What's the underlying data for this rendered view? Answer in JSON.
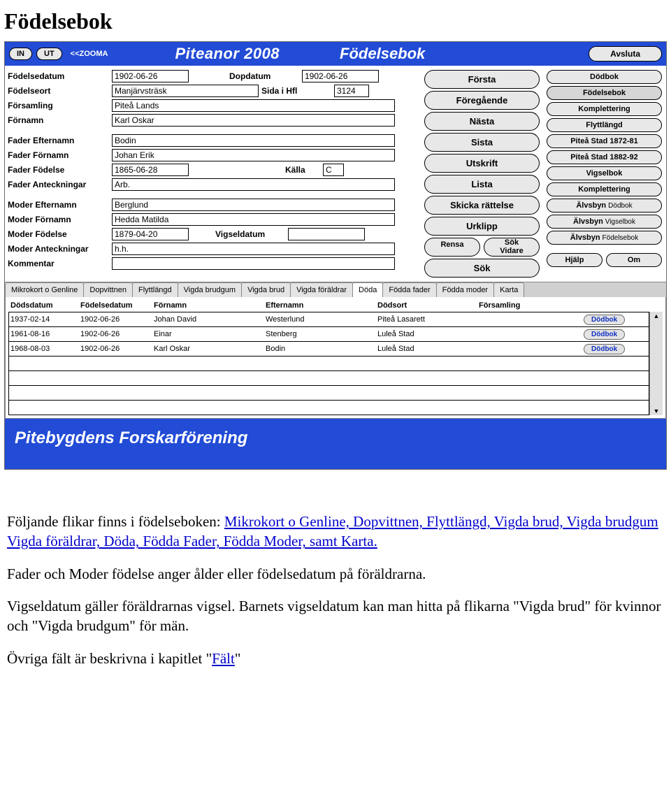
{
  "doc": {
    "title": "Födelsebok"
  },
  "toolbar": {
    "in": "IN",
    "ut": "UT",
    "zoom": "<<ZOOMA",
    "appTitle": "Piteanor 2008",
    "section": "Födelsebok",
    "quit": "Avsluta"
  },
  "form": {
    "labels": {
      "fodelsedatum": "Födelsedatum",
      "dopdatum": "Dopdatum",
      "fodelseort": "Födelseort",
      "sida": "Sida i Hfl",
      "forsamling": "Församling",
      "fornamn": "Förnamn",
      "faderEfternamn": "Fader Efternamn",
      "faderFornamn": "Fader Förnamn",
      "faderFodelse": "Fader Födelse",
      "kalla": "Källa",
      "faderAnt": "Fader Anteckningar",
      "moderEfternamn": "Moder Efternamn",
      "moderFornamn": "Moder Förnamn",
      "moderFodelse": "Moder Födelse",
      "vigseldatum": "Vigseldatum",
      "moderAnt": "Moder Anteckningar",
      "kommentar": "Kommentar"
    },
    "values": {
      "fodelsedatum": "1902-06-26",
      "dopdatum": "1902-06-26",
      "fodelseort": "Manjärvsträsk",
      "sida": "3124",
      "forsamling": "Piteå Lands",
      "fornamn": "Karl Oskar",
      "faderEfternamn": "Bodin",
      "faderFornamn": "Johan Erik",
      "faderFodelse": "1865-06-28",
      "kalla": "C",
      "faderAnt": "Arb.",
      "moderEfternamn": "Berglund",
      "moderFornamn": "Hedda Matilda",
      "moderFodelse": "1879-04-20",
      "vigseldatum": "",
      "moderAnt": "h.h.",
      "kommentar": ""
    }
  },
  "nav": {
    "forsta": "Första",
    "foreg": "Föregående",
    "nasta": "Nästa",
    "sista": "Sista",
    "utskrift": "Utskrift",
    "lista": "Lista",
    "skicka": "Skicka rättelse",
    "urklipp": "Urklipp",
    "rensa": "Rensa",
    "sokVidare": "Sök\nVidare",
    "sok": "Sök"
  },
  "links": {
    "dodbok": "Dödbok",
    "fodelsebok": "Födelsebok",
    "komplettering": "Komplettering",
    "flyttlangd": "Flyttlängd",
    "piteaStad1": "Piteå Stad 1872-81",
    "piteaStad2": "Piteå Stad 1882-92",
    "vigselbok": "Vigselbok",
    "komplettering2": "Komplettering",
    "alvsbyn": "Älvsbyn",
    "dodbokSm": "Dödbok",
    "vigselbokSm": "Vigselbok",
    "fodelsebokSm": "Födelsebok",
    "hjalp": "Hjälp",
    "om": "Om"
  },
  "tabs": {
    "items": [
      "Mikrokort o Genline",
      "Dopvittnen",
      "Flyttlängd",
      "Vigda brudgum",
      "Vigda brud",
      "Vigda föräldrar",
      "Döda",
      "Födda fader",
      "Födda moder",
      "Karta"
    ],
    "activeIndex": 6
  },
  "grid": {
    "headers": [
      "Dödsdatum",
      "Födelsedatum",
      "Förnamn",
      "Efternamn",
      "Dödsort",
      "Församling"
    ],
    "rows": [
      {
        "dods": "1937-02-14",
        "fod": "1902-06-26",
        "fornamn": "Johan David",
        "efternamn": "Westerlund",
        "dodsort": "Piteå Lasarett",
        "forsamling": "",
        "btn": "Dödbok"
      },
      {
        "dods": "1961-08-16",
        "fod": "1902-06-26",
        "fornamn": "Einar",
        "efternamn": "Stenberg",
        "dodsort": "Luleå Stad",
        "forsamling": "",
        "btn": "Dödbok"
      },
      {
        "dods": "1968-08-03",
        "fod": "1902-06-26",
        "fornamn": "Karl Oskar",
        "efternamn": "Bodin",
        "dodsort": "Luleå Stad",
        "forsamling": "",
        "btn": "Dödbok"
      }
    ]
  },
  "footer": {
    "text": "Pitebygdens Forskarförening"
  },
  "prose": {
    "p1a": "Följande flikar finns i födelseboken: ",
    "p1links": "Mikrokort o Genline, Dopvittnen, Flyttlängd, Vigda brud, Vigda brudgum Vigda föräldrar, Döda, Födda Fader, Födda Moder, samt Karta.",
    "p2": "Fader och Moder födelse anger ålder eller födelsedatum på föräldrarna.",
    "p3": "Vigseldatum gäller föräldrarnas vigsel. Barnets vigseldatum kan man hitta på flikarna \"Vigda brud\" för kvinnor och \"Vigda brudgum\" för män.",
    "p4a": "Övriga fält är beskrivna i kapitlet \"",
    "p4link": "Fält",
    "p4b": "\""
  }
}
